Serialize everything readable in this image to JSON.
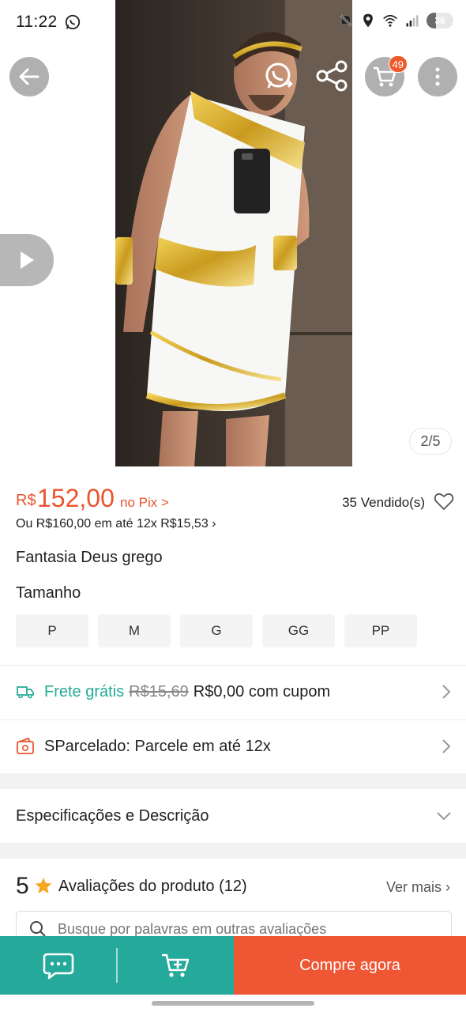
{
  "status_bar": {
    "time": "11:22",
    "battery": "36",
    "battery_level": 0.36,
    "icons": [
      "whatsapp-icon",
      "mute-icon",
      "location-icon",
      "wifi-icon",
      "signal-icon",
      "battery-icon"
    ]
  },
  "header": {
    "cart_count": "49",
    "image_counter": "2/5"
  },
  "price": {
    "currency": "R$",
    "value": "152,00",
    "pix_label": "no Pix >",
    "sold": "35 Vendido(s)",
    "installment": "Ou R$160,00 em até 12x R$15,53 ›"
  },
  "product": {
    "title": "Fantasia Deus grego"
  },
  "size": {
    "label": "Tamanho",
    "options": [
      "P",
      "M",
      "G",
      "GG",
      "PP"
    ]
  },
  "shipping": {
    "free_label": "Frete grátis",
    "old_price": "R$15,69",
    "new_price": "R$0,00 com cupom"
  },
  "installments_row": {
    "text": "SParcelado: Parcele em até 12x"
  },
  "specs": {
    "label": "Especificações e Descrição"
  },
  "reviews": {
    "rating": "5",
    "title": "Avaliações do produto",
    "count": "(12)",
    "see_more": "Ver mais ›",
    "search_placeholder": "Busque por palavras em outras avaliações"
  },
  "bottom_bar": {
    "buy_now": "Compre agora"
  },
  "colors": {
    "accent": "#ef5633",
    "teal": "#25a99a",
    "free_shipping": "#26aa99"
  }
}
